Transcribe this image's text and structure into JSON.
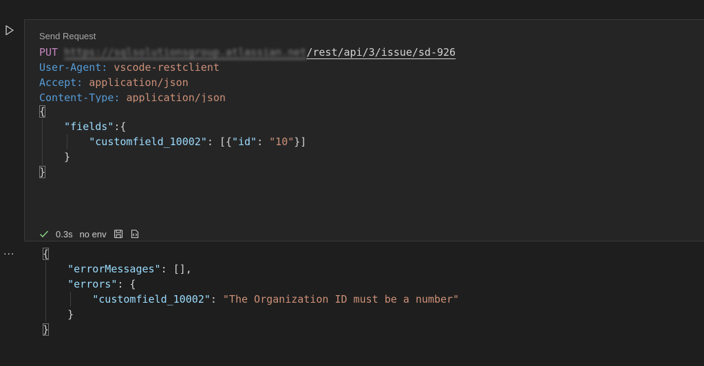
{
  "run": {
    "icon": "play-icon"
  },
  "request": {
    "send_label": "Send Request",
    "method": "PUT",
    "url_host": "https://sqlsolutionsgroup.atlassian.net",
    "url_path": "/rest/api/3/issue/sd-926",
    "headers": [
      {
        "name": "User-Agent:",
        "value": "vscode-restclient"
      },
      {
        "name": "Accept:",
        "value": "application/json"
      },
      {
        "name": "Content-Type:",
        "value": "application/json"
      }
    ],
    "body": {
      "open": "{",
      "fields_key": "\"fields\"",
      "fields_sep": ":{",
      "custom_key": "\"customfield_10002\"",
      "custom_sep": ": [{",
      "id_key": "\"id\"",
      "id_sep": ": ",
      "id_val": "\"10\"",
      "custom_end": "}]",
      "fields_close": "}",
      "close": "}"
    }
  },
  "status": {
    "check_icon": "check-icon",
    "time": "0.3s",
    "env": "no env",
    "save_icon": "save-icon",
    "code_icon": "code-icon"
  },
  "more": {
    "label": "···"
  },
  "response": {
    "open": "{",
    "error_messages_key": "\"errorMessages\"",
    "error_messages_val": ": [],",
    "errors_key": "\"errors\"",
    "errors_sep": ": {",
    "custom_key": "\"customfield_10002\"",
    "custom_sep": ": ",
    "custom_val": "\"The Organization ID must be a number\"",
    "errors_close": "}",
    "close": "}"
  }
}
